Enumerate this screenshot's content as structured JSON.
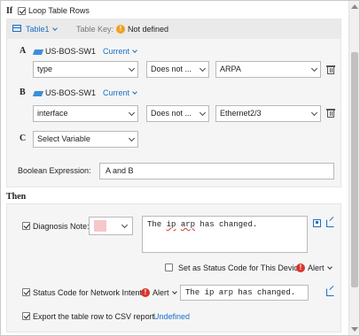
{
  "if_section": {
    "title": "If",
    "loop_table_rows_label": "Loop Table Rows",
    "loop_table_rows_checked": true
  },
  "table_bar": {
    "table_name": "Table1",
    "table_key_label": "Table Key:",
    "table_key_value": "Not defined"
  },
  "conditions": [
    {
      "letter": "A",
      "device": "US-BOS-SW1",
      "mode": "Current",
      "variable": "type",
      "operator": "Does not ...",
      "value": "ARPA"
    },
    {
      "letter": "B",
      "device": "US-BOS-SW1",
      "mode": "Current",
      "variable": "interface",
      "operator": "Does not ...",
      "value": "Ethernet2/3"
    },
    {
      "letter": "C",
      "variable_placeholder": "Select Variable"
    }
  ],
  "boolean_expression": {
    "label": "Boolean Expression:",
    "value": "A and B"
  },
  "then_section": {
    "title": "Then",
    "diagnosis_note_label": "Diagnosis Note:",
    "diagnosis_note_checked": true,
    "note_color": "#f7c6ca",
    "note_text_before": "The ",
    "note_text_w1": "ip",
    "note_text_mid": " ",
    "note_text_w2": "arp",
    "note_text_after": " has changed.",
    "set_status_label": "Set as Status Code for This Device",
    "set_status_checked": false,
    "set_status_level": "Alert",
    "status_network_label": "Status Code for Network Intent",
    "status_network_checked": true,
    "status_network_level": "Alert",
    "status_network_text": "The ip arp has changed.",
    "export_label": "Export the table row to CSV report",
    "export_checked": true,
    "export_value": "Undefined"
  },
  "colors": {
    "link_blue": "#1c6fc4",
    "warning_orange": "#f0a020",
    "alert_red": "#d9342b"
  }
}
